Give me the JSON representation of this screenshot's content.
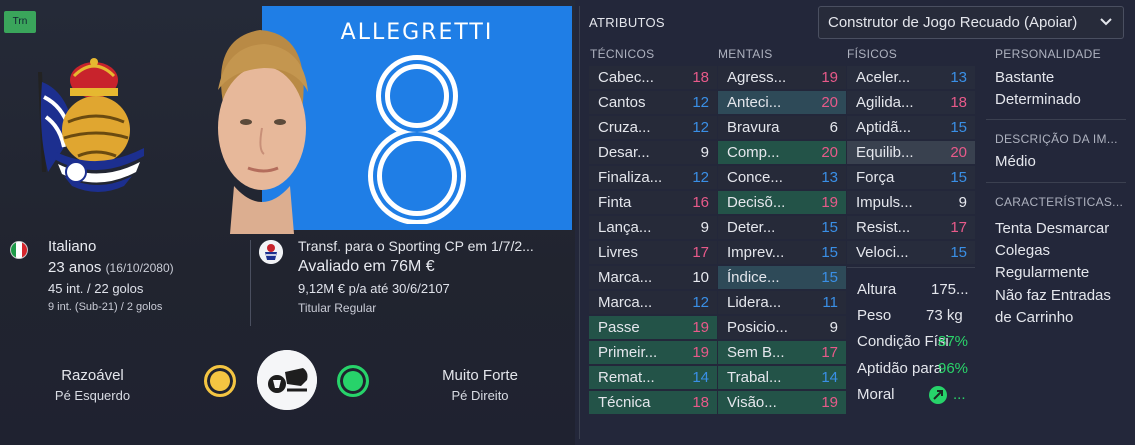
{
  "left": {
    "badge": "Trn",
    "shirt": {
      "name": "ALLEGRETTI",
      "number": "8"
    },
    "bio": {
      "nationality": "Italiano",
      "age": "23 anos",
      "dob": "(16/10/2080)",
      "caps": "45 int. / 22 golos",
      "u21": "9 int. (Sub-21) / 2 golos"
    },
    "contract": {
      "transfer": "Transf. para o Sporting CP em 1/7/2...",
      "value": "Avaliado em 76M €",
      "wage": "9,12M € p/a até 30/6/2107",
      "role": "Titular Regular"
    },
    "feet": {
      "left_rating": "Razoável",
      "left_label": "Pé Esquerdo",
      "right_rating": "Muito Forte",
      "right_label": "Pé Direito"
    }
  },
  "right": {
    "header": "ATRIBUTOS",
    "role_select": "Construtor de Jogo Recuado (Apoiar)",
    "col_tech": "TÉCNICOS",
    "col_mental": "MENTAIS",
    "col_phys": "FÍSICOS",
    "technical": [
      {
        "name": "Cabec...",
        "value": "18"
      },
      {
        "name": "Cantos",
        "value": "12"
      },
      {
        "name": "Cruza...",
        "value": "12"
      },
      {
        "name": "Desar...",
        "value": "9"
      },
      {
        "name": "Finaliza...",
        "value": "12"
      },
      {
        "name": "Finta",
        "value": "16"
      },
      {
        "name": "Lança...",
        "value": "9"
      },
      {
        "name": "Livres",
        "value": "17"
      },
      {
        "name": "Marca...",
        "value": "10"
      },
      {
        "name": "Marca...",
        "value": "12"
      },
      {
        "name": "Passe",
        "value": "19"
      },
      {
        "name": "Primeir...",
        "value": "19"
      },
      {
        "name": "Remat...",
        "value": "14"
      },
      {
        "name": "Técnica",
        "value": "18"
      }
    ],
    "mental": [
      {
        "name": "Agress...",
        "value": "19"
      },
      {
        "name": "Anteci...",
        "value": "20"
      },
      {
        "name": "Bravura",
        "value": "6"
      },
      {
        "name": "Comp...",
        "value": "20"
      },
      {
        "name": "Conce...",
        "value": "13"
      },
      {
        "name": "Decisõ...",
        "value": "19"
      },
      {
        "name": "Deter...",
        "value": "15"
      },
      {
        "name": "Imprev...",
        "value": "15"
      },
      {
        "name": "Índice...",
        "value": "15"
      },
      {
        "name": "Lidera...",
        "value": "11"
      },
      {
        "name": "Posicio...",
        "value": "9"
      },
      {
        "name": "Sem B...",
        "value": "17"
      },
      {
        "name": "Trabal...",
        "value": "14"
      },
      {
        "name": "Visão...",
        "value": "19"
      }
    ],
    "physical": [
      {
        "name": "Aceler...",
        "value": "13"
      },
      {
        "name": "Agilida...",
        "value": "18"
      },
      {
        "name": "Aptidã...",
        "value": "15"
      },
      {
        "name": "Equilib...",
        "value": "20"
      },
      {
        "name": "Força",
        "value": "15"
      },
      {
        "name": "Impuls...",
        "value": "9"
      },
      {
        "name": "Resist...",
        "value": "17"
      },
      {
        "name": "Veloci...",
        "value": "15"
      }
    ],
    "misc": {
      "height_label": "Altura",
      "height_value": "175...",
      "weight_label": "Peso",
      "weight_value": "73 kg",
      "condition_label": "Condição Físi",
      "condition_value": "87%",
      "fitness_label": "Aptidão para",
      "fitness_value": "96%",
      "morale_label": "Moral",
      "morale_value": "..."
    },
    "side": {
      "personality_h": "PERSONALIDADE",
      "personality_1": "Bastante",
      "personality_2": "Determinado",
      "media_h": "DESCRIÇÃO DA IM...",
      "media_t": "Médio",
      "traits_h": "CARACTERÍSTICAS...",
      "trait_1": "Tenta Desmarcar",
      "trait_2": "Colegas",
      "trait_3": "Regularmente",
      "trait_4": "Não faz Entradas",
      "trait_5": "de Carrinho"
    }
  },
  "colors": {
    "pink": "#e85a8a",
    "blue": "#3a8fe6",
    "green": "#27d36a",
    "yellow": "#f4c542",
    "shirt": "#1f7ee6"
  }
}
